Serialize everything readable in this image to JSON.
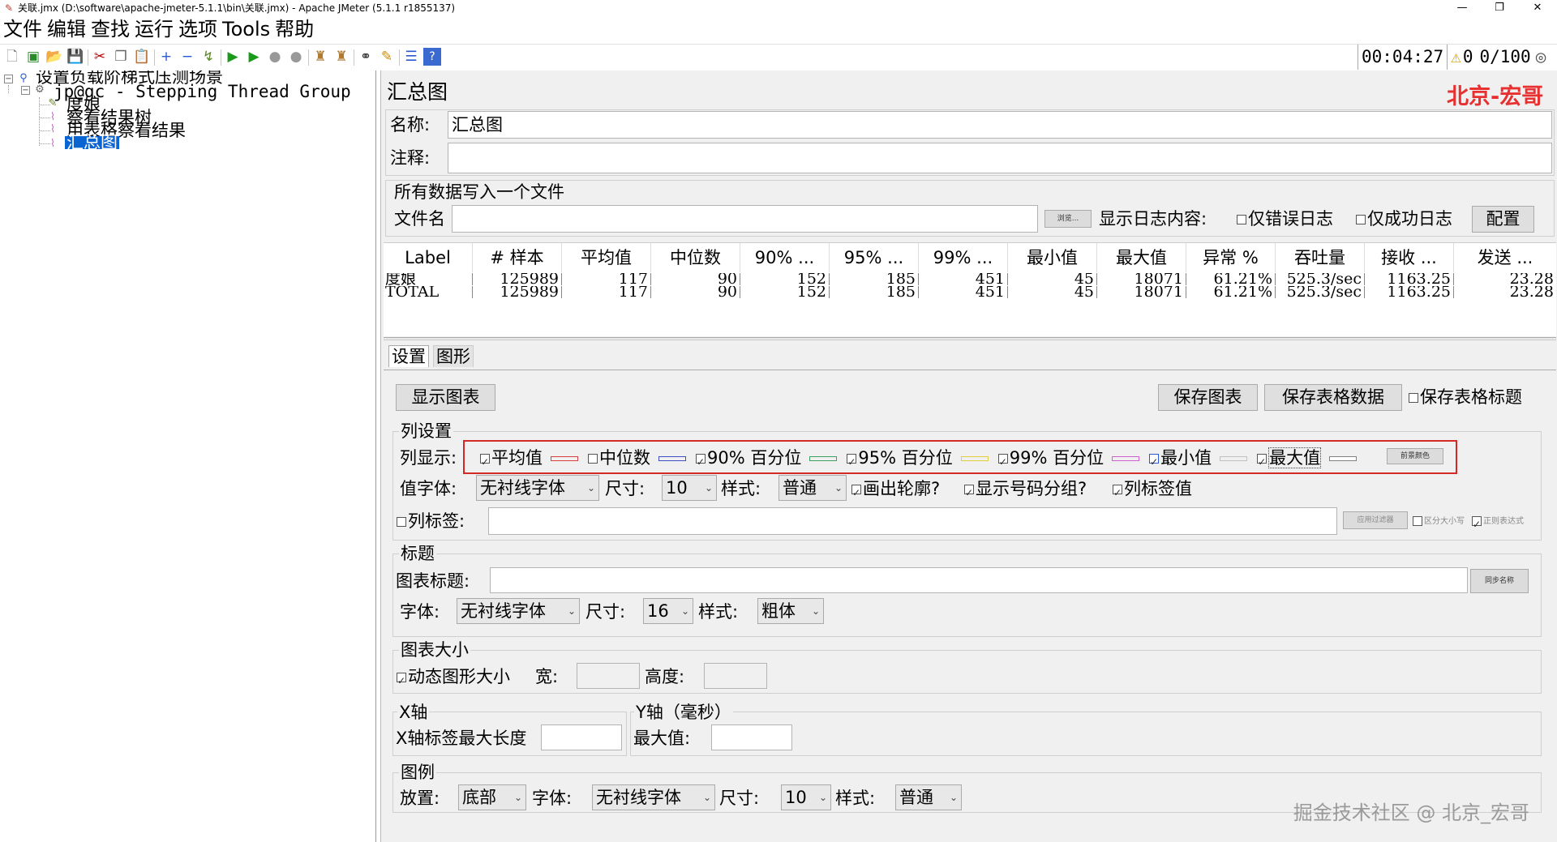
{
  "window": {
    "title": "关联.jmx (D:\\software\\apache-jmeter-5.1.1\\bin\\关联.jmx) - Apache JMeter (5.1.1 r1855137)",
    "minimize": "—",
    "maximize": "❐",
    "close": "✕"
  },
  "menu": [
    "文件",
    "编辑",
    "查找",
    "运行",
    "选项",
    "Tools",
    "帮助"
  ],
  "toolbar": {
    "timer": "00:04:27",
    "warn_icon": "⚠",
    "warn_count": "0",
    "threads": "0/100"
  },
  "tree": {
    "items": [
      {
        "label": "设置负载阶梯式压测场景"
      },
      {
        "label": "jp@gc - Stepping Thread Group"
      },
      {
        "label": "度娘"
      },
      {
        "label": "察看结果树"
      },
      {
        "label": "用表格察看结果"
      },
      {
        "label": "汇总图"
      }
    ]
  },
  "panel": {
    "title": "汇总图",
    "brand": "北京-宏哥",
    "name_label": "名称:",
    "name_value": "汇总图",
    "comment_label": "注释:",
    "comment_value": "",
    "file_section": "所有数据写入一个文件",
    "filename_label": "文件名",
    "browse": "浏览...",
    "log_label": "显示日志内容:",
    "errors_only": "仅错误日志",
    "success_only": "仅成功日志",
    "config": "配置"
  },
  "table": {
    "headers": [
      "Label",
      "# 样本",
      "平均值",
      "中位数",
      "90% ...",
      "95% ...",
      "99% ...",
      "最小值",
      "最大值",
      "异常 %",
      "吞吐量",
      "接收 ...",
      "发送 ..."
    ],
    "rows": [
      [
        "度娘",
        "125989",
        "117",
        "90",
        "152",
        "185",
        "451",
        "45",
        "18071",
        "61.21%",
        "525.3/sec",
        "1163.25",
        "23.28"
      ],
      [
        "TOTAL",
        "125989",
        "117",
        "90",
        "152",
        "185",
        "451",
        "45",
        "18071",
        "61.21%",
        "525.3/sec",
        "1163.25",
        "23.28"
      ]
    ]
  },
  "tabs": [
    "设置",
    "图形"
  ],
  "settings": {
    "show_chart": "显示图表",
    "save_chart": "保存图表",
    "save_table": "保存表格数据",
    "save_table_header": "保存表格标题",
    "col_settings": "列设置",
    "col_display": "列显示:",
    "columns": [
      {
        "label": "平均值",
        "checked": true,
        "color": "#d84040"
      },
      {
        "label": "中位数",
        "checked": false,
        "color": "#4050c8"
      },
      {
        "label": "90% 百分位",
        "checked": true,
        "color": "#40a060"
      },
      {
        "label": "95% 百分位",
        "checked": true,
        "color": "#e0d040"
      },
      {
        "label": "99% 百分位",
        "checked": true,
        "color": "#d060d0"
      },
      {
        "label": "最小值",
        "checked": true,
        "color": "#c0c0c0"
      },
      {
        "label": "最大值",
        "checked": true,
        "color": "#808080"
      }
    ],
    "fg_color": "前景颜色",
    "value_font_label": "值字体:",
    "value_font": "无衬线字体",
    "size_label": "尺寸:",
    "value_size": "10",
    "style_label": "样式:",
    "value_style": "普通",
    "draw_outline": "画出轮廓?",
    "show_grouping": "显示号码分组?",
    "col_label_value": "列标签值",
    "col_label": "列标签:",
    "apply_filter": "应用过滤器",
    "case_sensitive": "区分大小写",
    "regex": "正则表达式",
    "title_section": "标题",
    "chart_title_label": "图表标题:",
    "sync_name": "同步名称",
    "font_label": "字体:",
    "title_font": "无衬线字体",
    "title_size": "16",
    "title_style": "粗体",
    "size_section": "图表大小",
    "dynamic_size": "动态图形大小",
    "width_label": "宽:",
    "height_label": "高度:",
    "xaxis_section": "X轴",
    "xaxis_label_len": "X轴标签最大长度",
    "yaxis_section": "Y轴（毫秒）",
    "ymax_label": "最大值:",
    "legend_section": "图例",
    "placement_label": "放置:",
    "placement": "底部",
    "legend_font": "无衬线字体",
    "legend_size": "10",
    "legend_style": "普通"
  },
  "watermark": "掘金技术社区 @ 北京_宏哥"
}
